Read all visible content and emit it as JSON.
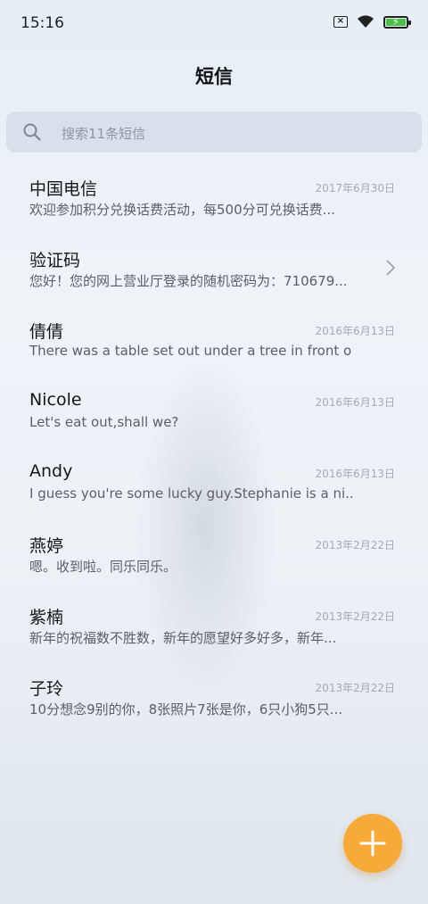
{
  "status_bar": {
    "time": "15:16"
  },
  "header": {
    "title": "短信"
  },
  "search": {
    "placeholder": "搜索11条短信"
  },
  "messages": [
    {
      "name": "中国电信",
      "date": "2017年6月30日",
      "preview": "欢迎参加积分兑换话费活动，每500分可兑换话费..."
    },
    {
      "name": "验证码",
      "date": "",
      "preview": "您好！您的网上营业厅登录的随机密码为：710679..."
    },
    {
      "name": "倩倩",
      "date": "2016年6月13日",
      "preview": "There was a table set out under a tree in front o..."
    },
    {
      "name": "Nicole",
      "date": "2016年6月13日",
      "preview": "Let's eat out,shall we?"
    },
    {
      "name": "Andy",
      "date": "2016年6月13日",
      "preview": "I guess you're some lucky guy.Stephanie is a ni..."
    },
    {
      "name": "燕婷",
      "date": "2013年2月22日",
      "preview": "嗯。收到啦。同乐同乐。"
    },
    {
      "name": "紫楠",
      "date": "2013年2月22日",
      "preview": "新年的祝福数不胜数，新年的愿望好多好多，新年..."
    },
    {
      "name": "子玲",
      "date": "2013年2月22日",
      "preview": "10分想念9别的你，8张照片7张是你，6只小狗5只..."
    }
  ],
  "colors": {
    "fab": "#f7a93a",
    "battery": "#4cc04a"
  },
  "icons": {
    "search": "search-icon",
    "fab": "plus-icon",
    "folder_chevron": "chevron-right-icon"
  }
}
